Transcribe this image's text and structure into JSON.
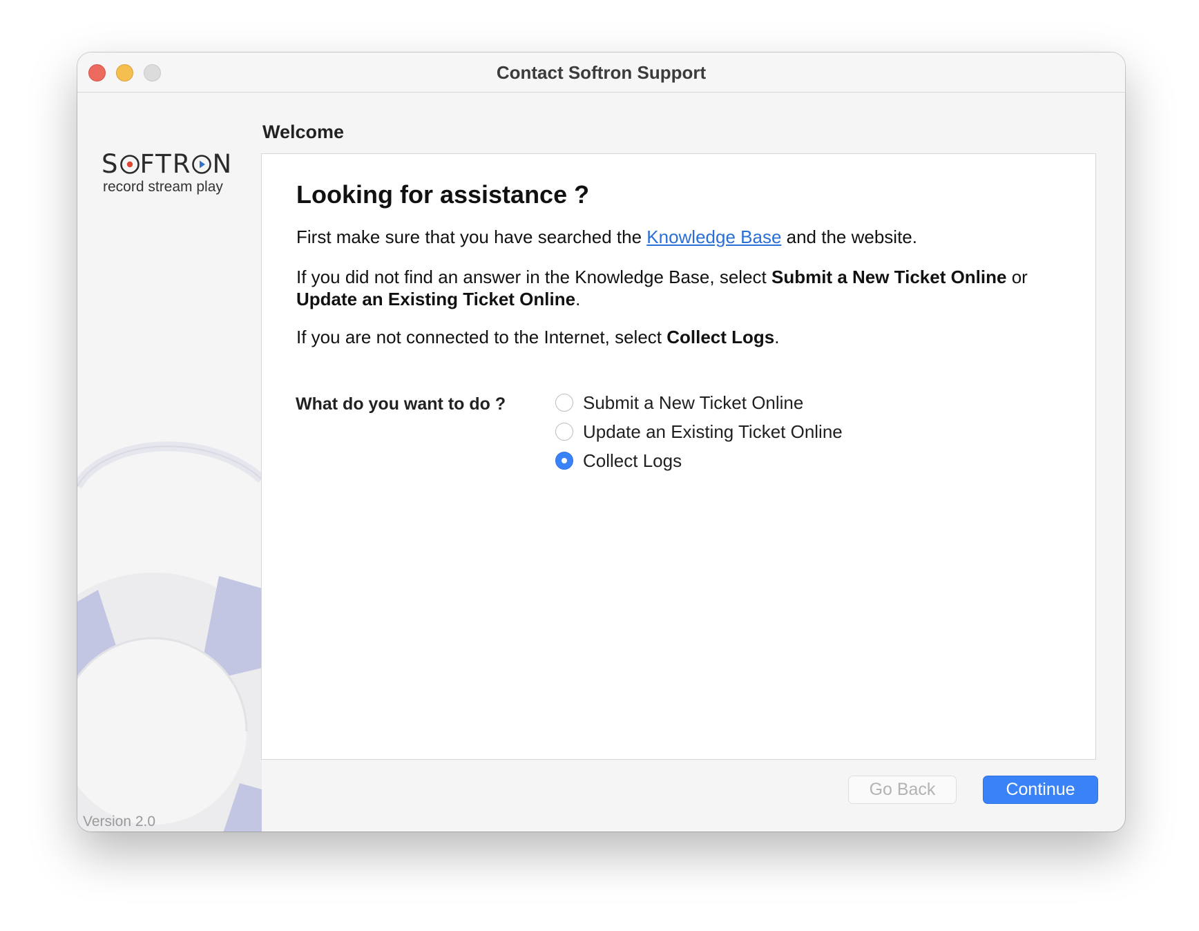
{
  "window": {
    "title": "Contact Softron Support"
  },
  "sidebar": {
    "logo_word_prefix": "S",
    "logo_word_mid": "FTR",
    "logo_word_suffix": "N",
    "logo_tagline": "record stream play",
    "version": "Version 2.0"
  },
  "main": {
    "section_label": "Welcome",
    "heading": "Looking for assistance ?",
    "para1_before": "First make sure that you have searched the ",
    "para1_link": "Knowledge Base",
    "para1_after": " and the website.",
    "para2_before": "If you did not find an answer in the Knowledge Base, select ",
    "para2_bold1": "Submit a New Ticket Online",
    "para2_mid": " or ",
    "para2_bold2": "Update an Existing Ticket Online",
    "para2_end": ".",
    "para3_before": "If you are not connected to the Internet, select ",
    "para3_bold": "Collect Logs",
    "para3_end": ".",
    "question": "What do you want to do ?",
    "options": [
      {
        "label": "Submit a New Ticket Online",
        "selected": false
      },
      {
        "label": "Update an Existing Ticket Online",
        "selected": false
      },
      {
        "label": "Collect Logs",
        "selected": true
      }
    ]
  },
  "footer": {
    "back_label": "Go Back",
    "continue_label": "Continue"
  },
  "colors": {
    "accent": "#3a82f7",
    "link": "#2a6fd6",
    "close": "#ed6a5e",
    "minimize": "#f5bf4f",
    "zoom_disabled": "#dcdcdc",
    "lifebuoy_stripe": "#c0c3e0"
  }
}
